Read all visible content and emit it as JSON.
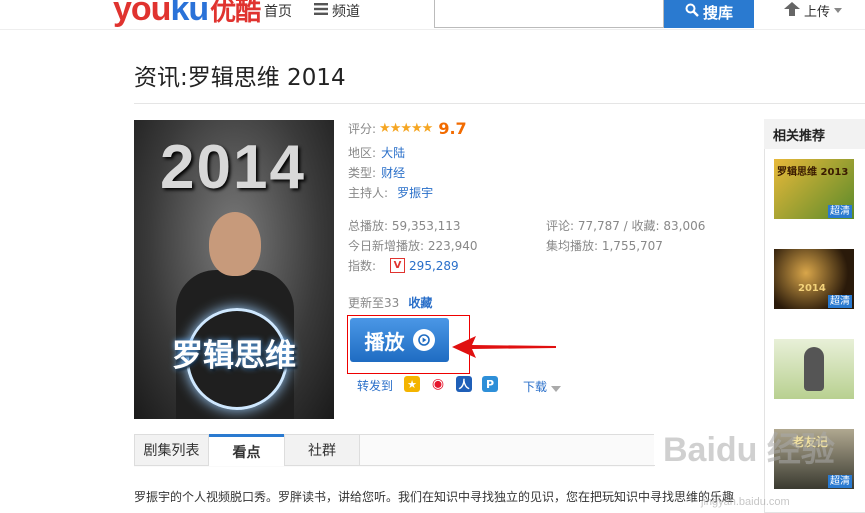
{
  "header": {
    "logo_latin": "youku",
    "logo_cn": "优酷",
    "nav_home": "首页",
    "nav_channels": "频道",
    "search_placeholder": "",
    "search_button": "搜库",
    "upload": "上传"
  },
  "page_title": "资讯:罗辑思维 2014",
  "poster": {
    "year": "2014",
    "name": "罗辑思维"
  },
  "info": {
    "rating_label": "评分:",
    "stars": "★★★★★",
    "score": "9.7",
    "region_label": "地区:",
    "region": "大陆",
    "type_label": "类型:",
    "type": "财经",
    "host_label": "主持人:",
    "host": "罗振宇",
    "total_plays": "总播放: 59,353,113",
    "today_plays": "今日新增播放: 223,940",
    "index_label": "指数:",
    "index_value": "295,289",
    "comments": "评论: 77,787 / 收藏: 83,006",
    "avg_plays": "集均播放: 1,755,707",
    "update_text": "更新至33",
    "favorite": "收藏"
  },
  "play_button": "播放",
  "share": {
    "label": "转发到",
    "download": "下载"
  },
  "tabs": [
    {
      "label": "剧集列表"
    },
    {
      "label": "看点"
    },
    {
      "label": "社群"
    }
  ],
  "description": "罗振宇的个人视频脱口秀。罗胖读书，讲给您听。我们在知识中寻找独立的见识，您在把玩知识中寻找思维的乐趣",
  "related": {
    "title": "相关推荐",
    "items": [
      {
        "badge": "超清",
        "caption": "罗辑思维 2013"
      },
      {
        "badge": "超清",
        "caption": "2014"
      },
      {
        "badge": ""
      },
      {
        "badge": "超清",
        "caption": "老友记"
      }
    ]
  },
  "watermark": {
    "text": "Baidu 经验",
    "url": "jingyan.baidu.com"
  },
  "colors": {
    "brand_blue": "#2a7ad0",
    "brand_red": "#e0332f",
    "score_orange": "#f26b00"
  }
}
